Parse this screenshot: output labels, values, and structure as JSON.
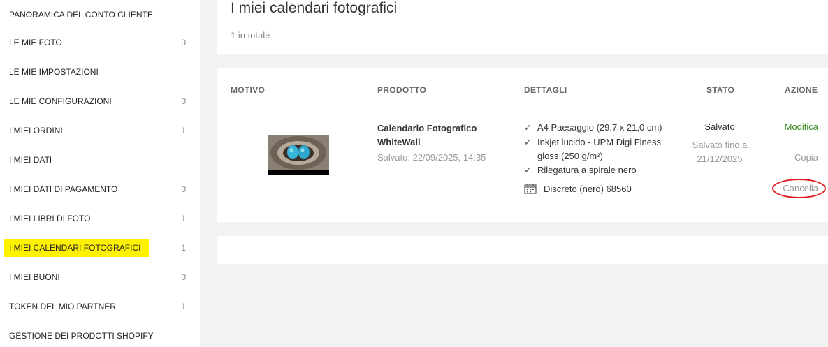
{
  "sidebar": {
    "items": [
      {
        "label": "PANORAMICA DEL CONTO CLIENTE",
        "count": ""
      },
      {
        "label": "LE MIE FOTO",
        "count": "0"
      },
      {
        "label": "LE MIE IMPOSTAZIONI",
        "count": ""
      },
      {
        "label": "LE MIE CONFIGURAZIONI",
        "count": "0"
      },
      {
        "label": "I MIEI ORDINI",
        "count": "1"
      },
      {
        "label": "I MIEI DATI",
        "count": ""
      },
      {
        "label": "I MIEI DATI DI PAGAMENTO",
        "count": "0"
      },
      {
        "label": "I MIEI LIBRI DI FOTO",
        "count": "1"
      },
      {
        "label": "I MIEI CALENDARI FOTOGRAFICI",
        "count": "1",
        "active": true
      },
      {
        "label": "I MIEI BUONI",
        "count": "0"
      },
      {
        "label": "TOKEN DEL MIO PARTNER",
        "count": "1"
      },
      {
        "label": "GESTIONE DEI PRODOTTI SHOPIFY",
        "count": ""
      }
    ],
    "highlight_color": "#fff200"
  },
  "header": {
    "title": "I miei calendari fotografici",
    "total": "1 in totale"
  },
  "table": {
    "columns": {
      "motivo": "MOTIVO",
      "prodotto": "PRODOTTO",
      "dettagli": "DETTAGLI",
      "stato": "STATO",
      "azione": "AZIONE"
    },
    "row": {
      "thumbnail_icon": "bird-nest-eggs-photo",
      "product_name": "Calendario Fotografico WhiteWall",
      "saved_date": "Salvato: 22/09/2025, 14:35",
      "details": [
        "A4 Paesaggio (29,7 x 21,0 cm)",
        "Inkjet lucido - UPM Digi Finess gloss (250 g/m²)",
        "Rilegatura a spirale nero"
      ],
      "calendar_label": "Discreto (nero) 68560",
      "status": "Salvato",
      "status_sub": "Salvato fino a 21/12/2025",
      "actions": {
        "edit": "Modifica",
        "copy": "Copia",
        "delete": "Cancella"
      }
    }
  },
  "colors": {
    "accent_green": "#3a8c1f",
    "annotation_red": "#e0191e"
  }
}
